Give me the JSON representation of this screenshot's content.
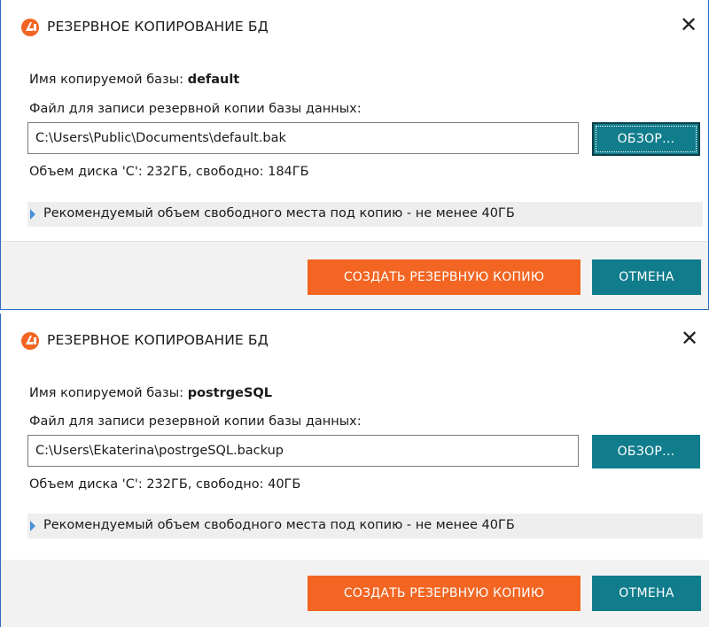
{
  "dialogs": [
    {
      "title": "РЕЗЕРВНОЕ КОПИРОВАНИЕ БД",
      "close_symbol": "✕",
      "db_name_label": "Имя копируемой базы: ",
      "db_name_value": "default",
      "file_label": "Файл для записи резервной копии базы данных:",
      "file_path": "C:\\Users\\Public\\Documents\\default.bak",
      "browse_label": "ОБЗОР...",
      "disk_info": "Объем диска 'C': 232ГБ, свободно: 184ГБ",
      "hint": "Рекомендуемый объем свободного места под копию - не менее 40ГБ",
      "create_label": "СОЗДАТЬ РЕЗЕРВНУЮ КОПИЮ",
      "cancel_label": "ОТМЕНА",
      "browse_focused": true
    },
    {
      "title": "РЕЗЕРВНОЕ КОПИРОВАНИЕ БД",
      "close_symbol": "✕",
      "db_name_label": "Имя копируемой базы: ",
      "db_name_value": "postrgeSQL",
      "file_label": "Файл для записи резервной копии базы данных:",
      "file_path": "C:\\Users\\Ekaterina\\postrgeSQL.backup",
      "browse_label": "ОБЗОР...",
      "disk_info": "Объем диска 'C': 232ГБ, свободно: 40ГБ",
      "hint": "Рекомендуемый объем свободного места под копию - не менее 40ГБ",
      "create_label": "СОЗДАТЬ РЕЗЕРВНУЮ КОПИЮ",
      "cancel_label": "ОТМЕНА",
      "browse_focused": false
    }
  ],
  "colors": {
    "accent_teal": "#117d8c",
    "accent_orange": "#f26522",
    "window_border": "#2b6cc4",
    "hint_arrow": "#4a90d9"
  },
  "icons": {
    "logo": "app-logo-icon",
    "close": "close-icon",
    "hint": "expand-arrow-icon"
  }
}
